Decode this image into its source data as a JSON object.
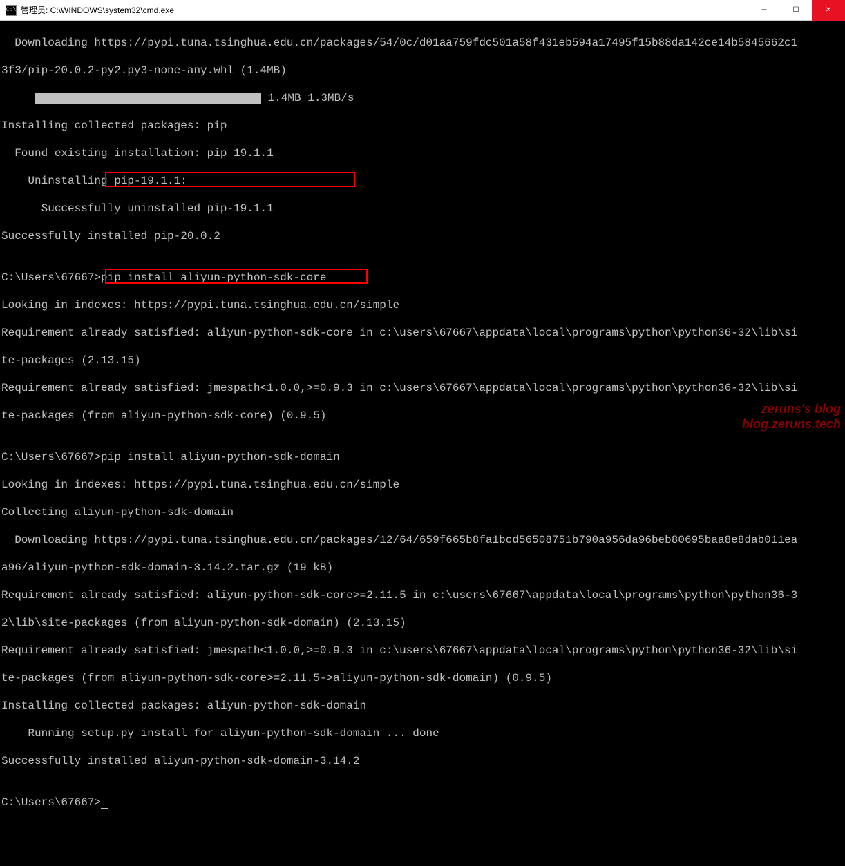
{
  "titlebar": {
    "icon_label": "C:\\",
    "title": "管理员: C:\\WINDOWS\\system32\\cmd.exe"
  },
  "window_controls": {
    "minimize": "─",
    "maximize": "☐",
    "close": "✕"
  },
  "terminal": {
    "l01": "  Downloading https://pypi.tuna.tsinghua.edu.cn/packages/54/0c/d01aa759fdc501a58f431eb594a17495f15b88da142ce14b5845662c1",
    "l02": "3f3/pip-20.0.2-py2.py3-none-any.whl (1.4MB)",
    "l03_prefix": "     ",
    "l03_suffix": " 1.4MB 1.3MB/s",
    "l04": "Installing collected packages: pip",
    "l05": "  Found existing installation: pip 19.1.1",
    "l06": "    Uninstalling pip-19.1.1:",
    "l07": "      Successfully uninstalled pip-19.1.1",
    "l08": "Successfully installed pip-20.0.2",
    "l09": "",
    "l10": "C:\\Users\\67667>pip install aliyun-python-sdk-core",
    "l11": "Looking in indexes: https://pypi.tuna.tsinghua.edu.cn/simple",
    "l12": "Requirement already satisfied: aliyun-python-sdk-core in c:\\users\\67667\\appdata\\local\\programs\\python\\python36-32\\lib\\si",
    "l13": "te-packages (2.13.15)",
    "l14": "Requirement already satisfied: jmespath<1.0.0,>=0.9.3 in c:\\users\\67667\\appdata\\local\\programs\\python\\python36-32\\lib\\si",
    "l15": "te-packages (from aliyun-python-sdk-core) (0.9.5)",
    "l16": "",
    "l17": "C:\\Users\\67667>pip install aliyun-python-sdk-domain",
    "l18": "Looking in indexes: https://pypi.tuna.tsinghua.edu.cn/simple",
    "l19": "Collecting aliyun-python-sdk-domain",
    "l20": "  Downloading https://pypi.tuna.tsinghua.edu.cn/packages/12/64/659f665b8fa1bcd56508751b790a956da96beb80695baa8e8dab011ea",
    "l21": "a96/aliyun-python-sdk-domain-3.14.2.tar.gz (19 kB)",
    "l22": "Requirement already satisfied: aliyun-python-sdk-core>=2.11.5 in c:\\users\\67667\\appdata\\local\\programs\\python\\python36-3",
    "l23": "2\\lib\\site-packages (from aliyun-python-sdk-domain) (2.13.15)",
    "l24": "Requirement already satisfied: jmespath<1.0.0,>=0.9.3 in c:\\users\\67667\\appdata\\local\\programs\\python\\python36-32\\lib\\si",
    "l25": "te-packages (from aliyun-python-sdk-core>=2.11.5->aliyun-python-sdk-domain) (0.9.5)",
    "l26": "Installing collected packages: aliyun-python-sdk-domain",
    "l27": "    Running setup.py install for aliyun-python-sdk-domain ... done",
    "l28": "Successfully installed aliyun-python-sdk-domain-3.14.2",
    "l29": "",
    "l30": "C:\\Users\\67667>"
  },
  "watermark": {
    "line1": "zeruns's blog",
    "line2": "blog.zeruns.tech"
  }
}
